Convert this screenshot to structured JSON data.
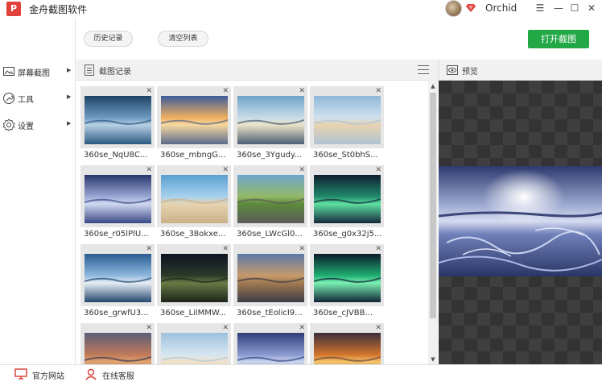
{
  "app": {
    "logo_text": "P",
    "title": "金舟截图软件"
  },
  "user": {
    "name": "Orchid"
  },
  "window_controls": {
    "menu": "☰",
    "minimize": "—",
    "maximize": "☐",
    "close": "✕"
  },
  "toolbar": {
    "history_label": "历史记录",
    "clear_label": "清空列表",
    "open_label": "打开截图"
  },
  "sidebar": {
    "items": [
      {
        "label": "屏幕截图",
        "icon": "screen-icon"
      },
      {
        "label": "工具",
        "icon": "tools-icon"
      },
      {
        "label": "设置",
        "icon": "settings-icon"
      }
    ]
  },
  "history": {
    "header": "截图记录",
    "items": [
      {
        "name": "360se_NqU8C...",
        "scene": "ocean"
      },
      {
        "name": "360se_mbngG...",
        "scene": "sunset"
      },
      {
        "name": "360se_3Ygudy...",
        "scene": "moon"
      },
      {
        "name": "360se_St0bhS...",
        "scene": "balloons"
      },
      {
        "name": "360se_r05lPlU...",
        "scene": "ice"
      },
      {
        "name": "360se_38okxe...",
        "scene": "beach"
      },
      {
        "name": "360se_LWcGl0...",
        "scene": "road"
      },
      {
        "name": "360se_g0x32j5...",
        "scene": "aurora"
      },
      {
        "name": "360se_grwfU3...",
        "scene": "glacier"
      },
      {
        "name": "360se_LilMMW...",
        "scene": "night"
      },
      {
        "name": "360se_tEolicI9...",
        "scene": "desert-road"
      },
      {
        "name": "360se_cJVBB...",
        "scene": "aurora2"
      },
      {
        "name": "",
        "scene": "dusk"
      },
      {
        "name": "",
        "scene": "balloons2"
      },
      {
        "name": "",
        "scene": "ice2"
      },
      {
        "name": "",
        "scene": "sunrise"
      }
    ]
  },
  "preview": {
    "header": "预览"
  },
  "footer": {
    "website_label": "官方网站",
    "support_label": "在线客服"
  }
}
